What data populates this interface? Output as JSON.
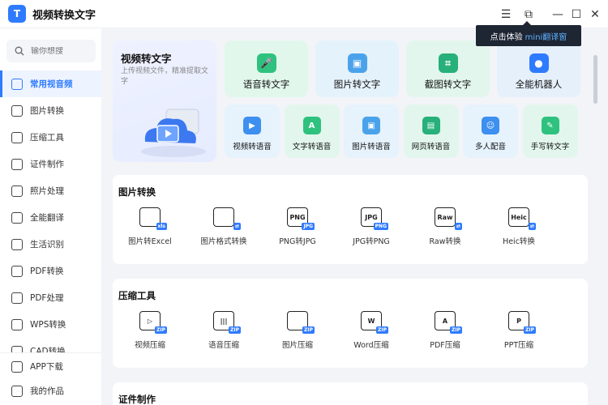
{
  "app": {
    "logo": "T",
    "title": "视频转换文字"
  },
  "window": {
    "menu_icon": "☰",
    "mini_icon": "⧉",
    "minimize": "—",
    "maximize": "☐",
    "close": "✕"
  },
  "tooltip": {
    "prefix": "点击体验",
    "highlight": "mini翻译窗"
  },
  "search": {
    "placeholder": "输你想搜"
  },
  "sidebar": {
    "items": [
      {
        "label": "常用视音频",
        "icon": "video-icon"
      },
      {
        "label": "图片转换",
        "icon": "image-icon"
      },
      {
        "label": "压缩工具",
        "icon": "compress-icon"
      },
      {
        "label": "证件制作",
        "icon": "id-photo-icon"
      },
      {
        "label": "照片处理",
        "icon": "photo-icon"
      },
      {
        "label": "全能翻译",
        "icon": "translate-icon"
      },
      {
        "label": "生活识别",
        "icon": "scan-icon"
      },
      {
        "label": "PDF转换",
        "icon": "pdf-icon"
      },
      {
        "label": "PDF处理",
        "icon": "pdf-edit-icon"
      },
      {
        "label": "WPS转换",
        "icon": "wps-icon"
      },
      {
        "label": "CAD转换",
        "icon": "cad-icon"
      }
    ],
    "bottom": [
      {
        "label": "APP下载",
        "icon": "phone-icon"
      },
      {
        "label": "我的作品",
        "icon": "folder-icon"
      }
    ]
  },
  "hero": {
    "title": "视频转文字",
    "subtitle": "上传视频文件，精准提取文字"
  },
  "feature_cards": [
    {
      "label": "语音转文字",
      "icon": "microphone-icon"
    },
    {
      "label": "图片转文字",
      "icon": "image-text-icon"
    },
    {
      "label": "截图转文字",
      "icon": "screenshot-icon"
    },
    {
      "label": "全能机器人",
      "icon": "robot-icon"
    }
  ],
  "small_cards": [
    {
      "label": "视频转语音",
      "icon": "video-audio-icon"
    },
    {
      "label": "文字转语音",
      "icon": "text-audio-icon"
    },
    {
      "label": "图片转语音",
      "icon": "image-audio-icon"
    },
    {
      "label": "网页转语音",
      "icon": "web-audio-icon"
    },
    {
      "label": "多人配音",
      "icon": "dubbing-icon"
    },
    {
      "label": "手写转文字",
      "icon": "handwriting-icon"
    }
  ],
  "sections": [
    {
      "title": "图片转换",
      "tools": [
        {
          "label": "图片转Excel",
          "glyph": "",
          "badge": "xls"
        },
        {
          "label": "图片格式转换",
          "glyph": "",
          "badge": "⇄"
        },
        {
          "label": "PNG转JPG",
          "glyph": "PNG",
          "badge": "JPG"
        },
        {
          "label": "JPG转PNG",
          "glyph": "JPG",
          "badge": "PNG"
        },
        {
          "label": "Raw转换",
          "glyph": "Raw",
          "badge": "⇄"
        },
        {
          "label": "Heic转换",
          "glyph": "Heic",
          "badge": "⇄"
        }
      ]
    },
    {
      "title": "压缩工具",
      "tools": [
        {
          "label": "视频压缩",
          "glyph": "▷",
          "badge": "ZIP"
        },
        {
          "label": "语音压缩",
          "glyph": "|||",
          "badge": "ZIP"
        },
        {
          "label": "图片压缩",
          "glyph": "",
          "badge": "ZIP"
        },
        {
          "label": "Word压缩",
          "glyph": "W",
          "badge": "ZIP"
        },
        {
          "label": "PDF压缩",
          "glyph": "A",
          "badge": "ZIP"
        },
        {
          "label": "PPT压缩",
          "glyph": "P",
          "badge": "ZIP"
        }
      ]
    },
    {
      "title": "证件制作",
      "tools": []
    }
  ],
  "colors": {
    "accent": "#2f7bff",
    "green_card": "#e3f7ee",
    "blue_card": "#e6f3fc",
    "teal_card": "#e4f6ef",
    "robot_card": "#e6f1fb"
  }
}
